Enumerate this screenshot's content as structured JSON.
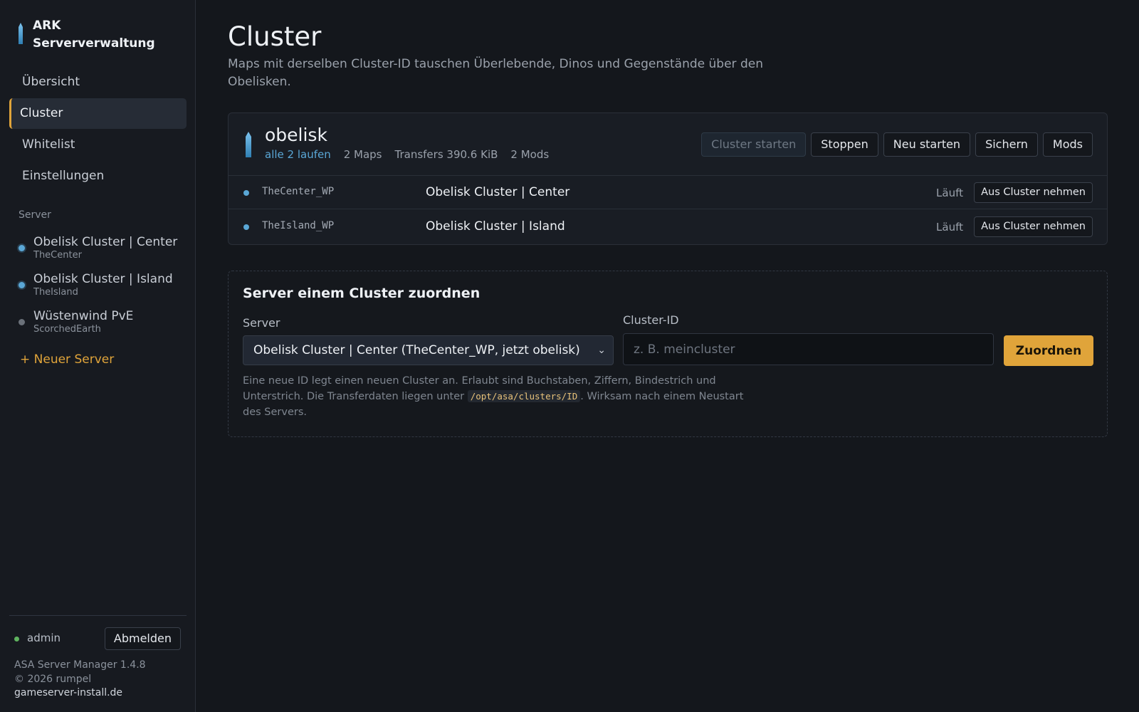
{
  "brand": {
    "line1": "ARK",
    "line2": "Serververwaltung"
  },
  "nav": [
    {
      "label": "Übersicht",
      "active": false
    },
    {
      "label": "Cluster",
      "active": true
    },
    {
      "label": "Whitelist",
      "active": false
    },
    {
      "label": "Einstellungen",
      "active": false
    }
  ],
  "sidebar": {
    "server_section_label": "Server",
    "servers": [
      {
        "name": "Obelisk Cluster | Center",
        "map": "TheCenter",
        "status": "running"
      },
      {
        "name": "Obelisk Cluster | Island",
        "map": "TheIsland",
        "status": "running"
      },
      {
        "name": "Wüstenwind PvE",
        "map": "ScorchedEarth",
        "status": "stopped"
      }
    ],
    "new_server": "+ Neuer Server",
    "user": "admin",
    "logout": "Abmelden",
    "version": "ASA Server Manager 1.4.8",
    "copyright": "© 2026 rumpel",
    "site": "gameserver-install.de"
  },
  "page": {
    "title": "Cluster",
    "description": "Maps mit derselben Cluster-ID tauschen Überlebende, Dinos und Gegenstände über den Obelisken."
  },
  "cluster": {
    "name": "obelisk",
    "status": "alle 2 laufen",
    "maps": "2 Maps",
    "transfers": "Transfers 390.6 KiB",
    "mods": "2 Mods",
    "actions": {
      "start": "Cluster starten",
      "stop": "Stoppen",
      "restart": "Neu starten",
      "backup": "Sichern",
      "mods": "Mods"
    },
    "members": [
      {
        "map": "TheCenter_WP",
        "name": "Obelisk Cluster | Center",
        "status": "Läuft",
        "action": "Aus Cluster nehmen"
      },
      {
        "map": "TheIsland_WP",
        "name": "Obelisk Cluster | Island",
        "status": "Läuft",
        "action": "Aus Cluster nehmen"
      }
    ]
  },
  "assign": {
    "title": "Server einem Cluster zuordnen",
    "server_label": "Server",
    "server_selected": "Obelisk Cluster | Center (TheCenter_WP, jetzt obelisk)",
    "cluster_id_label": "Cluster-ID",
    "cluster_id_placeholder": "z. B. meincluster",
    "cluster_id_value": "",
    "submit": "Zuordnen",
    "help_before": "Eine neue ID legt einen neuen Cluster an. Erlaubt sind Buchstaben, Ziffern, Bindestrich und Unterstrich. Die Transferdaten liegen unter ",
    "help_code": "/opt/asa/clusters/ID",
    "help_after": ". Wirksam nach einem Neustart des Servers."
  },
  "colors": {
    "accent": "#e0a43a",
    "running": "#5aa7d6",
    "online": "#5fb35f",
    "stopped": "#6b717a"
  },
  "icons": {
    "brand": "obelisk-icon",
    "cluster": "obelisk-icon",
    "select": "chevron-down-icon"
  }
}
